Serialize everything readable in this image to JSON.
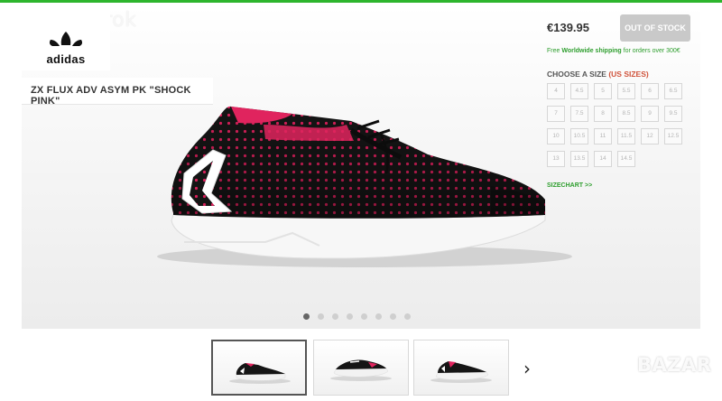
{
  "watermark": "pushmorok",
  "brand": {
    "logo_text": "adidas"
  },
  "product": {
    "title": "ZX FLUX ADV ASYM PK \"SHOCK PINK\""
  },
  "purchase": {
    "price": "€139.95",
    "stock_button": "OUT OF STOCK",
    "shipping_pre": "Free ",
    "shipping_bold": "Worldwide shipping",
    "shipping_post": " for orders over 300€",
    "choose_label": "CHOOSE A SIZE ",
    "choose_unit": "(US SIZES)",
    "sizes": [
      "4",
      "4.5",
      "5",
      "5.5",
      "6",
      "6.5",
      "7",
      "7.5",
      "8",
      "8.5",
      "9",
      "9.5",
      "10",
      "10.5",
      "11",
      "11.5",
      "12",
      "12.5",
      "13",
      "13.5",
      "14",
      "14.5"
    ],
    "sizechart_link": "SIZECHART >>"
  },
  "gallery": {
    "slide_count": 8,
    "active_slide": 1,
    "thumbnail_count": 3,
    "next_icon": "chevron-right-icon"
  },
  "corner_watermark": "BAZAR",
  "colors": {
    "accent_green": "#2db52d",
    "shoe_pink": "#e0245e",
    "shoe_black": "#151515"
  }
}
